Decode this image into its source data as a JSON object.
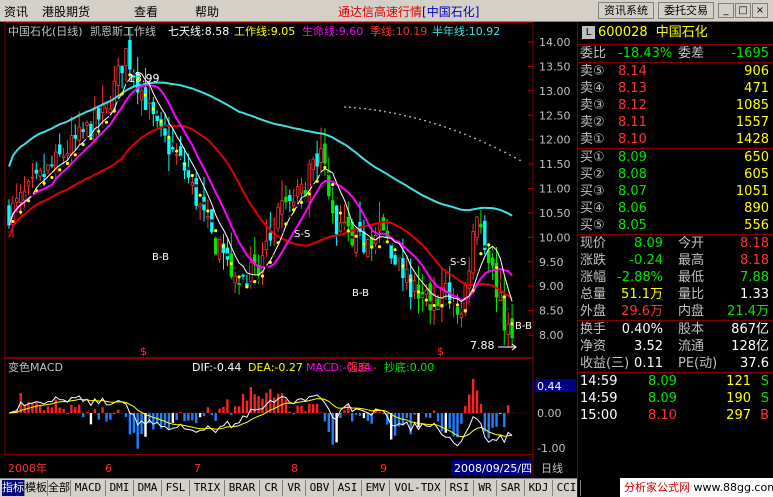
{
  "menu": [
    "资讯",
    "港股期货",
    "查看",
    "帮助"
  ],
  "app_title": "通达信高速行情",
  "app_code": "[中国石化]",
  "toolbar_buttons": [
    "资讯系统",
    "委托交易"
  ],
  "window_buttons": [
    "_",
    "□",
    "×"
  ],
  "chart_header": {
    "stock": "中国石化(日线)",
    "indicator": "凯恩斯工作线",
    "ma7": "七天线:8.58",
    "work": "工作线:9.05",
    "life": "生命线:9.60",
    "season": "季线:10.19",
    "half": "半年线:10.92"
  },
  "price_axis": [
    "14.00",
    "13.50",
    "13.00",
    "12.50",
    "12.00",
    "11.50",
    "11.00",
    "10.50",
    "10.00",
    "9.50",
    "9.00",
    "8.50",
    "8.00"
  ],
  "annotations": {
    "high": "13.99",
    "low": "7.88",
    "bb": "B-B",
    "ss": "S-S",
    "dollar": "$"
  },
  "macd_header": {
    "name": "变色MACD",
    "dif": "DIF:-0.44",
    "dea": "DEA:-0.27",
    "macd": "MACD:-0.34",
    "strength": "强度:-",
    "bottom": "抄底:0.00"
  },
  "macd_axis": {
    "top": "0.44",
    "zero": "0.00",
    "bottom": "-1.00"
  },
  "date_axis": {
    "year": "2008年",
    "m6": "6",
    "m7": "7",
    "m8": "8",
    "m9": "9",
    "current": "2008/09/25/四",
    "period": "日线"
  },
  "quote": {
    "code": "600028",
    "name": "中国石化",
    "webi_label": "委比",
    "webi": "-18.43%",
    "weicha_label": "委差",
    "weicha": "-1695",
    "asks": [
      {
        "label": "卖⑤",
        "price": "8.14",
        "vol": "906"
      },
      {
        "label": "卖④",
        "price": "8.13",
        "vol": "471"
      },
      {
        "label": "卖③",
        "price": "8.12",
        "vol": "1085"
      },
      {
        "label": "卖②",
        "price": "8.11",
        "vol": "1557"
      },
      {
        "label": "卖①",
        "price": "8.10",
        "vol": "1428"
      }
    ],
    "bids": [
      {
        "label": "买①",
        "price": "8.09",
        "vol": "650"
      },
      {
        "label": "买②",
        "price": "8.08",
        "vol": "605"
      },
      {
        "label": "买③",
        "price": "8.07",
        "vol": "1051"
      },
      {
        "label": "买④",
        "price": "8.06",
        "vol": "890"
      },
      {
        "label": "买⑤",
        "price": "8.05",
        "vol": "556"
      }
    ],
    "stats": [
      {
        "l1": "现价",
        "v1": "8.09",
        "l2": "今开",
        "v2": "8.18"
      },
      {
        "l1": "涨跌",
        "v1": "-0.24",
        "l2": "最高",
        "v2": "8.18"
      },
      {
        "l1": "涨幅",
        "v1": "-2.88%",
        "l2": "最低",
        "v2": "7.88"
      },
      {
        "l1": "总量",
        "v1": "51.1万",
        "l2": "量比",
        "v2": "1.33"
      },
      {
        "l1": "外盘",
        "v1": "29.6万",
        "l2": "内盘",
        "v2": "21.4万"
      }
    ],
    "stats2": [
      {
        "l1": "换手",
        "v1": "0.40%",
        "l2": "股本",
        "v2": "867亿"
      },
      {
        "l1": "净资",
        "v1": "3.52",
        "l2": "流通",
        "v2": "128亿"
      },
      {
        "l1": "收益(三)",
        "v1": "0.11",
        "l2": "PE(动)",
        "v2": "37.6"
      }
    ],
    "ticks": [
      {
        "time": "14:59",
        "price": "8.09",
        "vol": "121",
        "flag": "S"
      },
      {
        "time": "14:59",
        "price": "8.09",
        "vol": "190",
        "flag": "S"
      },
      {
        "time": "15:00",
        "price": "8.10",
        "vol": "297",
        "flag": "B"
      }
    ]
  },
  "tabs": [
    "指标",
    "模板",
    "全部",
    "MACD",
    "DMI",
    "DMA",
    "FSL",
    "TRIX",
    "BRAR",
    "CR",
    "VR",
    "OBV",
    "ASI",
    "EMV",
    "VOL-TDX",
    "RSI",
    "WR",
    "SAR",
    "KDJ",
    "CCI"
  ],
  "banner": {
    "site": "分析家公式网",
    "url": "www.88gg.com"
  },
  "colors": {
    "up": "#ff3232",
    "down": "#00ffff",
    "green_candle": "#00e600",
    "ma_red": "#e00000",
    "ma_magenta": "#ff00ff",
    "ma_cyan": "#40e0e0",
    "dots_yellow": "#ffff00"
  }
}
